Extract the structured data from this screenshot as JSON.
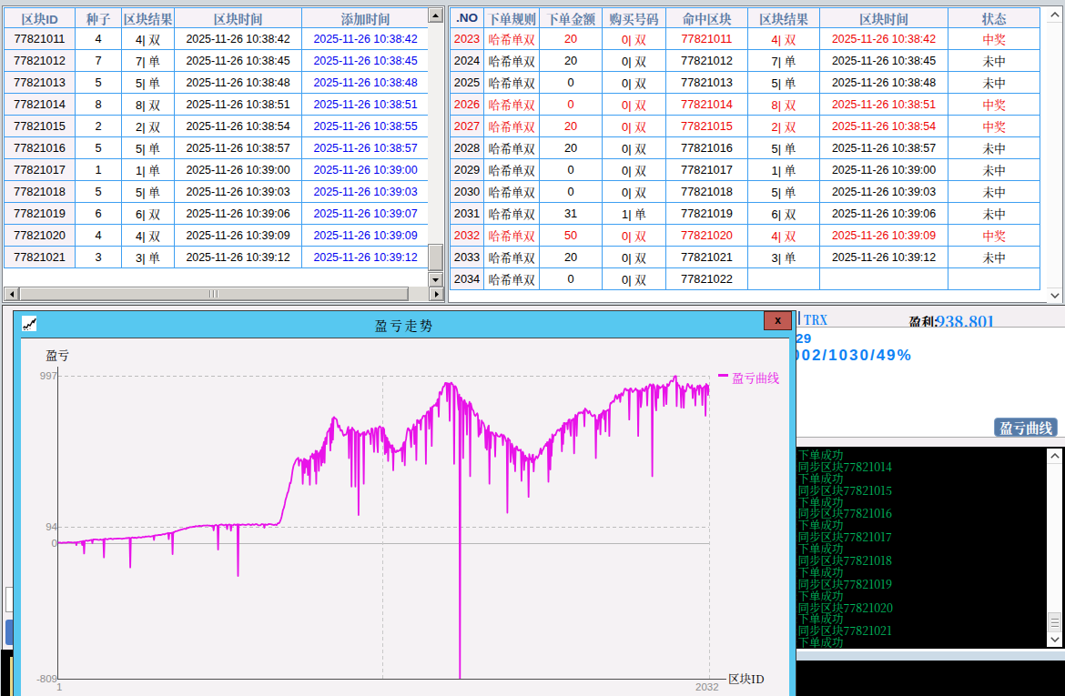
{
  "colors": {
    "grid_blue": "#3d9ff2",
    "header_text": "#5a7aa4",
    "no_header_text": "#1f3d7d",
    "time_blue": "#0000f0",
    "win_red": "#e60000",
    "titlebar_blue": "#57c8f0",
    "close_red": "#c05a52",
    "magenta": "#e813e8",
    "console_green": "#00b55e",
    "trx_blue": "#1a75d8",
    "button_blue": "#567ba8"
  },
  "left_table": {
    "headers": [
      "区块ID",
      "种子",
      "区块结果",
      "区块时间",
      "添加时间"
    ],
    "rows": [
      [
        "77821011",
        "4",
        "4| 双",
        "2025-11-26 10:38:42",
        "2025-11-26 10:38:42"
      ],
      [
        "77821012",
        "7",
        "7| 单",
        "2025-11-26 10:38:45",
        "2025-11-26 10:38:45"
      ],
      [
        "77821013",
        "5",
        "5| 单",
        "2025-11-26 10:38:48",
        "2025-11-26 10:38:48"
      ],
      [
        "77821014",
        "8",
        "8| 双",
        "2025-11-26 10:38:51",
        "2025-11-26 10:38:51"
      ],
      [
        "77821015",
        "2",
        "2| 双",
        "2025-11-26 10:38:54",
        "2025-11-26 10:38:55"
      ],
      [
        "77821016",
        "5",
        "5| 单",
        "2025-11-26 10:38:57",
        "2025-11-26 10:38:57"
      ],
      [
        "77821017",
        "1",
        "1| 单",
        "2025-11-26 10:39:00",
        "2025-11-26 10:39:00"
      ],
      [
        "77821018",
        "5",
        "5| 单",
        "2025-11-26 10:39:03",
        "2025-11-26 10:39:03"
      ],
      [
        "77821019",
        "6",
        "6| 双",
        "2025-11-26 10:39:06",
        "2025-11-26 10:39:07"
      ],
      [
        "77821020",
        "4",
        "4| 双",
        "2025-11-26 10:39:09",
        "2025-11-26 10:39:09"
      ],
      [
        "77821021",
        "3",
        "3| 单",
        "2025-11-26 10:39:12",
        "2025-11-26 10:39:12"
      ]
    ]
  },
  "right_table": {
    "headers": [
      ".NO",
      "下单规则",
      "下单金额",
      "购买号码",
      "命中区块",
      "区块结果",
      "区块时间",
      "状态"
    ],
    "rows": [
      {
        "cells": [
          "2023",
          "哈希单双",
          "20",
          "0| 双",
          "77821011",
          "4| 双",
          "2025-11-26 10:38:42",
          "中奖"
        ],
        "win": true
      },
      {
        "cells": [
          "2024",
          "哈希单双",
          "20",
          "0| 双",
          "77821012",
          "7| 单",
          "2025-11-26 10:38:45",
          "未中"
        ],
        "win": false
      },
      {
        "cells": [
          "2025",
          "哈希单双",
          "0",
          "0| 双",
          "77821013",
          "5| 单",
          "2025-11-26 10:38:48",
          "未中"
        ],
        "win": false
      },
      {
        "cells": [
          "2026",
          "哈希单双",
          "0",
          "0| 双",
          "77821014",
          "8| 双",
          "2025-11-26 10:38:51",
          "中奖"
        ],
        "win": true
      },
      {
        "cells": [
          "2027",
          "哈希单双",
          "20",
          "0| 双",
          "77821015",
          "2| 双",
          "2025-11-26 10:38:54",
          "中奖"
        ],
        "win": true
      },
      {
        "cells": [
          "2028",
          "哈希单双",
          "20",
          "0| 双",
          "77821016",
          "5| 单",
          "2025-11-26 10:38:57",
          "未中"
        ],
        "win": false
      },
      {
        "cells": [
          "2029",
          "哈希单双",
          "0",
          "0| 双",
          "77821017",
          "1| 单",
          "2025-11-26 10:39:00",
          "未中"
        ],
        "win": false
      },
      {
        "cells": [
          "2030",
          "哈希单双",
          "0",
          "0| 双",
          "77821018",
          "5| 单",
          "2025-11-26 10:39:03",
          "未中"
        ],
        "win": false
      },
      {
        "cells": [
          "2031",
          "哈希单双",
          "31",
          "1| 单",
          "77821019",
          "6| 双",
          "2025-11-26 10:39:06",
          "未中"
        ],
        "win": false
      },
      {
        "cells": [
          "2032",
          "哈希单双",
          "50",
          "0| 双",
          "77821020",
          "4| 双",
          "2025-11-26 10:39:09",
          "中奖"
        ],
        "win": true
      },
      {
        "cells": [
          "2033",
          "哈希单双",
          "20",
          "0| 双",
          "77821021",
          "3| 单",
          "2025-11-26 10:39:12",
          "未中"
        ],
        "win": false
      },
      {
        "cells": [
          "2034",
          "哈希单双",
          "0",
          "0| 双",
          "77821022",
          "",
          "",
          ""
        ],
        "win": false
      }
    ]
  },
  "chart_window": {
    "title": "盈亏走势",
    "close_label": "x",
    "y_axis_label": "盈亏",
    "x_axis_label": "区块ID",
    "y_ticks": [
      "997",
      "94",
      "0",
      "-809"
    ],
    "x_ticks": [
      "1",
      "2032"
    ],
    "legend": "盈亏曲线"
  },
  "chart_data": {
    "type": "line",
    "title": "盈亏走势",
    "series_name": "盈亏曲线",
    "xlabel": "区块ID",
    "ylabel": "盈亏",
    "xlim": [
      1,
      2032
    ],
    "ylim": [
      -809,
      997
    ],
    "y_gridlines": [
      997,
      94,
      0
    ],
    "x_gridlines": [
      1016,
      2032
    ],
    "x_start": 1,
    "x_step": 2,
    "values": [
      3,
      3,
      4,
      4,
      4,
      2,
      1,
      1,
      3,
      4,
      4,
      3,
      2,
      2,
      4,
      5,
      6,
      6,
      5,
      5,
      5,
      5,
      4,
      4,
      4,
      4,
      5,
      5,
      5,
      -12,
      6,
      6,
      6,
      6,
      7,
      9,
      9,
      10,
      -12,
      13,
      13,
      -62,
      13,
      14,
      15,
      15,
      14,
      13,
      15,
      16,
      17,
      18,
      19,
      19,
      -1,
      22,
      22,
      22,
      23,
      23,
      22,
      21,
      21,
      20,
      19,
      20,
      22,
      22,
      20,
      20,
      21,
      23,
      -85,
      25,
      26,
      25,
      24,
      23,
      23,
      25,
      26,
      26,
      27,
      27,
      26,
      24,
      24,
      26,
      26,
      26,
      26,
      27,
      26,
      28,
      27,
      27,
      28,
      28,
      27,
      26,
      25,
      26,
      28,
      28,
      28,
      29,
      30,
      30,
      30,
      30,
      32,
      32,
      32,
      -145,
      31,
      32,
      34,
      33,
      32,
      31,
      33,
      33,
      31,
      31,
      32,
      35,
      36,
      35,
      34,
      33,
      33,
      35,
      37,
      37,
      36,
      36,
      38,
      40,
      39,
      39,
      40,
      40,
      41,
      40,
      39,
      39,
      41,
      42,
      42,
      44,
      19,
      46,
      47,
      47,
      47,
      46,
      48,
      49,
      49,
      49,
      49,
      49,
      50,
      52,
      53,
      53,
      52,
      53,
      56,
      57,
      58,
      59,
      61,
      24,
      60,
      60,
      60,
      59,
      62,
      -65,
      65,
      63,
      67,
      70,
      71,
      71,
      72,
      74,
      76,
      77,
      78,
      79,
      81,
      81,
      82,
      83,
      84,
      86,
      86,
      85,
      85,
      88,
      90,
      92,
      92,
      94,
      96,
      96,
      96,
      96,
      97,
      98,
      98,
      98,
      100,
      102,
      101,
      100,
      100,
      102,
      103,
      104,
      103,
      102,
      102,
      102,
      104,
      105,
      105,
      105,
      105,
      105,
      105,
      107,
      106,
      105,
      104,
      105,
      104,
      103,
      103,
      105,
      104,
      76,
      104,
      106,
      108,
      109,
      106,
      104,
      -38,
      106,
      109,
      110,
      111,
      112,
      112,
      109,
      108,
      106,
      108,
      109,
      111,
      111,
      84,
      107,
      109,
      112,
      111,
      109,
      74,
      108,
      107,
      106,
      110,
      112,
      111,
      108,
      109,
      111,
      113,
      -196,
      112,
      111,
      110,
      108,
      110,
      111,
      112,
      111,
      111,
      110,
      109,
      108,
      109,
      111,
      112,
      113,
      112,
      112,
      109,
      107,
      109,
      112,
      113,
      111,
      110,
      111,
      113,
      114,
      113,
      112,
      108,
      107,
      107,
      107,
      107,
      111,
      114,
      113,
      112,
      112,
      92,
      112,
      112,
      110,
      110,
      110,
      113,
      114,
      114,
      113,
      113,
      113,
      111,
      111,
      109,
      108,
      109,
      112,
      110,
      108,
      113,
      119,
      119,
      119,
      125,
      135,
      144,
      158,
      175,
      196,
      206,
      217,
      234,
      257,
      269,
      281,
      297,
      304,
      318,
      340,
      360,
      358,
      377,
      406,
      433,
      452,
      468,
      474,
      483,
      492,
      499,
      503,
      506,
      510,
      463,
      494,
      493,
      500,
      492,
      483,
      354,
      494,
      505,
      419,
      501,
      453,
      495,
      493,
      407,
      480,
      496,
      349,
      519,
      513,
      523,
      535,
      504,
      526,
      531,
      430,
      552,
      355,
      551,
      536,
      531,
      432,
      541,
      543,
      556,
      464,
      574,
      483,
      585,
      605,
      480,
      626,
      631,
      591,
      659,
      666,
      671,
      677,
      686,
      553,
      711,
      600,
      743,
      619,
      752,
      753,
      745,
      743,
      742,
      736,
      713,
      692,
      700,
      703,
      686,
      671,
      674,
      675,
      662,
      647,
      641,
      646,
      649,
      647,
      651,
      667,
      685,
      695,
      508,
      674,
      670,
      679,
      338,
      690,
      683,
      679,
      675,
      666,
      338,
      660,
      663,
      665,
      671,
      168,
      656,
      646,
      641,
      650,
      655,
      656,
      661,
      355,
      663,
      649,
      647,
      648,
      661,
      672,
      673,
      659,
      651,
      652,
      591,
      684,
      685,
      678,
      624,
      545,
      637,
      688,
      688,
      684,
      589,
      542,
      687,
      694,
      698,
      693,
      691,
      613,
      607,
      690,
      687,
      678,
      532,
      644,
      541,
      630,
      626,
      491,
      606,
      595,
      573,
      569,
      585,
      542,
      585,
      435,
      569,
      556,
      547,
      543,
      545,
      554,
      548,
      549,
      553,
      556,
      554,
      566,
      570,
      488,
      584,
      600,
      603,
      465,
      606,
      621,
      653,
      675,
      687,
      684,
      672,
      675,
      624,
      574,
      676,
      678,
      695,
      710,
      592,
      691,
      696,
      496,
      734,
      735,
      730,
      716,
      720,
      735,
      677,
      739,
      743,
      755,
      761,
      759,
      757,
      762,
      474,
      771,
      785,
      779,
      788,
      683,
      744,
      809,
      808,
      580,
      816,
      814,
      821,
      825,
      821,
      822,
      836,
      819,
      857,
      861,
      756,
      898,
      904,
      898,
      887,
      899,
      923,
      935,
      935,
      942,
      957,
      957,
      955,
      848,
      955,
      949,
      953,
      730,
      947,
      958,
      958,
      948,
      947,
      930,
      474,
      936,
      938,
      932,
      922,
      901,
      832,
      796,
      888,
      -809,
      870,
      870,
      856,
      845,
      508,
      834,
      855,
      845,
      770,
      834,
      648,
      824,
      816,
      824,
      844,
      400,
      835,
      817,
      802,
      795,
      791,
      774,
      764,
      759,
      764,
      771,
      776,
      764,
      637,
      735,
      649,
      684,
      659,
      733,
      720,
      721,
      714,
      701,
      688,
      569,
      675,
      558,
      678,
      696,
      702,
      355,
      662,
      568,
      662,
      660,
      660,
      651,
      641,
      641,
      517,
      659,
      654,
      647,
      640,
      638,
      638,
      635,
      639,
      650,
      650,
      641,
      585,
      646,
      640,
      634,
      624,
      609,
      611,
      182,
      627,
      621,
      616,
      614,
      484,
      527,
      594,
      583,
      522,
      473,
      568,
      430,
      558,
      578,
      576,
      557,
      553,
      556,
      557,
      552,
      558,
      372,
      531,
      546,
      537,
      437,
      496,
      524,
      491,
      511,
      507,
      505,
      276,
      532,
      512,
      500,
      507,
      483,
      526,
      529,
      428,
      501,
      497,
      510,
      519,
      512,
      507,
      515,
      525,
      532,
      553,
      566,
      532,
      549,
      557,
      562,
      573,
      581,
      582,
      593,
      581,
      603,
      602,
      366,
      605,
      622,
      440,
      618,
      522,
      650,
      603,
      639,
      642,
      648,
      645,
      657,
      668,
      675,
      677,
      676,
      670,
      679,
      685,
      687,
      548,
      703,
      593,
      718,
      659,
      718,
      714,
      712,
      719,
      680,
      732,
      738,
      739,
      666,
      641,
      735,
      734,
      739,
      743,
      536,
      738,
      766,
      763,
      641,
      751,
      771,
      779,
      781,
      775,
      781,
      782,
      779,
      776,
      781,
      792,
      698,
      804,
      801,
      795,
      792,
      783,
      776,
      782,
      790,
      780,
      770,
      765,
      759,
      758,
      759,
      765,
      766,
      761,
      508,
      737,
      730,
      680,
      748,
      767,
      766,
      650,
      773,
      748,
      778,
      785,
      793,
      740,
      789,
      667,
      789,
      789,
      795,
      795,
      798,
      640,
      823,
      838,
      835,
      842,
      847,
      848,
      843,
      855,
      877,
      884,
      874,
      861,
      864,
      878,
      887,
      884,
      843,
      891,
      896,
      887,
      882,
      895,
      910,
      922,
      923,
      920,
      911,
      915,
      915,
      913,
      738,
      921,
      924,
      923,
      911,
      903,
      903,
      910,
      913,
      916,
      924,
      919,
      911,
      914,
      640,
      910,
      901,
      912,
      812,
      840,
      923,
      923,
      913,
      909,
      908,
      925,
      933,
      936,
      822,
      922,
      924,
      938,
      948,
      948,
      940,
      942,
      400,
      949,
      946,
      936,
      916,
      820,
      792,
      934,
      944,
      867,
      937,
      931,
      925,
      931,
      932,
      933,
      939,
      945,
      820,
      934,
      932,
      930,
      830,
      950,
      948,
      939,
      943,
      957,
      965,
      970,
      970,
      968,
      965,
      975,
      990,
      997,
      997,
      997,
      818,
      958,
      942,
      944,
      941,
      925,
      922,
      810,
      910,
      938,
      935,
      809,
      914,
      907,
      905,
      917,
      939,
      952,
      948,
      937,
      933,
      926,
      926,
      936,
      944,
      866,
      923,
      921,
      927,
      822,
      915,
      913,
      936,
      940,
      933,
      886,
      943,
      939,
      928,
      925,
      825,
      928,
      930,
      934,
      939,
      761,
      951,
      946,
      943,
      885,
      944
    ]
  },
  "trx_panel": {
    "coin": "TRX",
    "profit_label": "盈利:",
    "profit_value": "938.801",
    "stat_line1": "29",
    "stat_line2": "002/1030/49%",
    "curve_button": "盈亏曲线"
  },
  "console": {
    "lines": [
      ":下单成功",
      ":同步区块77821014",
      ":下单成功",
      ":同步区块77821015",
      ":下单成功",
      ":同步区块77821016",
      ":下单成功",
      ":同步区块77821017",
      ":下单成功",
      ":同步区块77821018",
      ":下单成功",
      ":同步区块77821019",
      ":下单成功",
      ":同步区块77821020",
      ":下单成功",
      ":同步区块77821021",
      ":下单成功"
    ]
  }
}
